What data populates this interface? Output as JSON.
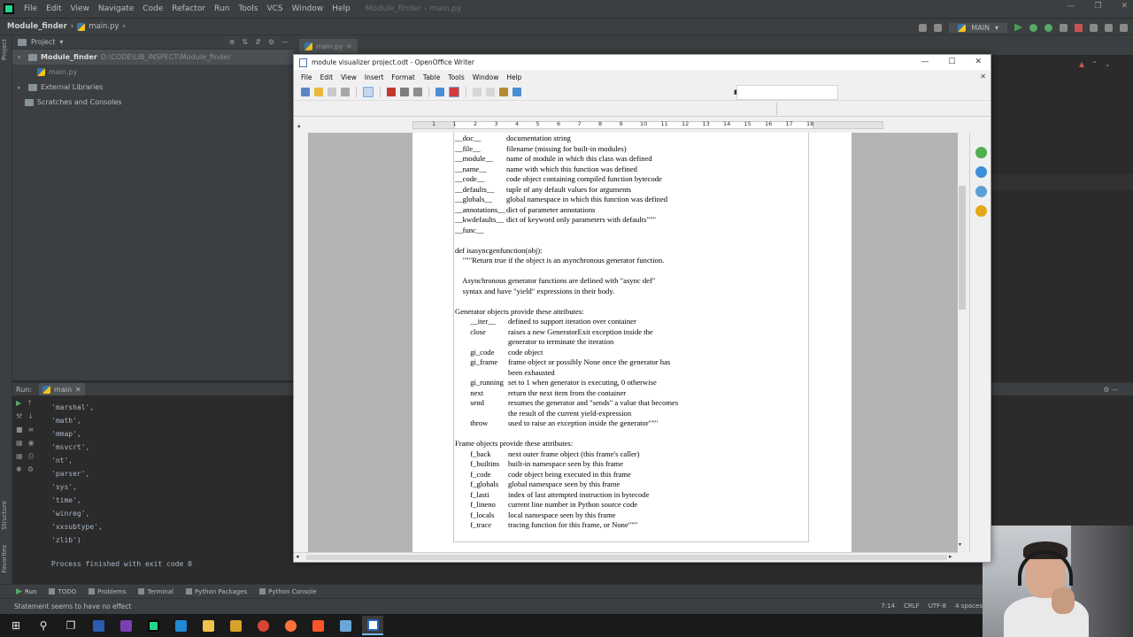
{
  "ide": {
    "menu": [
      "File",
      "Edit",
      "View",
      "Navigate",
      "Code",
      "Refactor",
      "Run",
      "Tools",
      "VCS",
      "Window",
      "Help"
    ],
    "window_title": "Module_finder - main.py",
    "breadcrumb": {
      "project": "Module_finder",
      "file": "main.py"
    },
    "run_config": "MAIN",
    "project_panel": {
      "title": "Project",
      "tree": {
        "root": "Module_finder",
        "root_path": "D:\\CODE\\LIB_INSPECT\\Module_finder",
        "file": "main.py",
        "external": "External Libraries",
        "scratches": "Scratches and Consoles"
      }
    },
    "editor_tab": "main.py",
    "run_panel": {
      "label": "Run:",
      "tab": "main",
      "output": [
        "'marshal',",
        "'math',",
        "'mmap',",
        "'msvcrt',",
        "'nt',",
        "'parser',",
        "'sys',",
        "'time',",
        "'winreg',",
        "'xxsubtype',",
        "'zlib')"
      ],
      "process": "Process finished with exit code 0"
    },
    "bottom_tabs": {
      "run": "Run",
      "todo": "TODO",
      "problems": "Problems",
      "terminal": "Terminal",
      "packages": "Python Packages",
      "console": "Python Console"
    },
    "status": {
      "message": "Statement seems to have no effect",
      "position": "7:14",
      "line_sep": "CRLF",
      "encoding": "UTF-8",
      "indent": "4 spaces"
    },
    "left_strip": {
      "project": "Project",
      "structure": "Structure",
      "favorites": "Favorites"
    }
  },
  "writer": {
    "title": "module visualizer project.odt - OpenOffice Writer",
    "menu": [
      "File",
      "Edit",
      "View",
      "Insert",
      "Format",
      "Table",
      "Tools",
      "Window",
      "Help"
    ],
    "ruler_numbers": [
      "1",
      "1",
      "2",
      "3",
      "4",
      "5",
      "6",
      "7",
      "8",
      "9",
      "10",
      "11",
      "12",
      "13",
      "14",
      "15",
      "16",
      "17",
      "18"
    ],
    "lines": [
      {
        "a": "__doc__",
        "b": "documentation string"
      },
      {
        "a": "__file__",
        "b": "filename (missing for built-in modules)"
      },
      {
        "a": "__module__",
        "b": "name of module in which this class was defined"
      },
      {
        "a": "__name__",
        "b": "name with which this function was defined"
      },
      {
        "a": "__code__",
        "b": "code object containing compiled function bytecode"
      },
      {
        "a": "__defaults__",
        "b": "tuple of any default values for arguments"
      },
      {
        "a": "__globals__",
        "b": "global namespace in which this function was defined"
      },
      {
        "a": "__annotations__",
        "b": "dict of parameter annotations"
      },
      {
        "a": "__kwdefaults__",
        "b": "dict of keyword only parameters with defaults\"\"\""
      },
      {
        "a": "__func__",
        "b": ""
      },
      {
        "a": "",
        "b": ""
      },
      {
        "a": "def isasyncgenfunction(obj):",
        "b": ""
      },
      {
        "a": "    \"\"\"Return true if the object is an asynchronous generator function.",
        "b": ""
      },
      {
        "a": "",
        "b": ""
      },
      {
        "a": "    Asynchronous generator functions are defined with \"async def\"",
        "b": ""
      },
      {
        "a": "    syntax and have \"yield\" expressions in their body.",
        "b": ""
      },
      {
        "a": "",
        "b": ""
      },
      {
        "a": "Generator objects provide these attributes:",
        "b": ""
      },
      {
        "a": "        __iter__",
        "b": "defined to support iteration over container"
      },
      {
        "a": "        close",
        "b": "raises a new GeneratorExit exception inside the"
      },
      {
        "a": "",
        "b": "generator to terminate the iteration"
      },
      {
        "a": "        gi_code",
        "b": "code object"
      },
      {
        "a": "        gi_frame",
        "b": "frame object or possibly None once the generator has"
      },
      {
        "a": "",
        "b": "been exhausted"
      },
      {
        "a": "        gi_running",
        "b": "set to 1 when generator is executing, 0 otherwise"
      },
      {
        "a": "        next",
        "b": "return the next item from the container"
      },
      {
        "a": "        send",
        "b": "resumes the generator and \"sends\" a value that becomes"
      },
      {
        "a": "",
        "b": "the result of the current yield-expression"
      },
      {
        "a": "        throw",
        "b": "used to raise an exception inside the generator\"\"\""
      },
      {
        "a": "",
        "b": ""
      },
      {
        "a": "Frame objects provide these attributes:",
        "b": ""
      },
      {
        "a": "        f_back",
        "b": "next outer frame object (this frame's caller)"
      },
      {
        "a": "        f_builtins",
        "b": "built-in namespace seen by this frame"
      },
      {
        "a": "        f_code",
        "b": "code object being executed in this frame"
      },
      {
        "a": "        f_globals",
        "b": "global namespace seen by this frame"
      },
      {
        "a": "        f_lasti",
        "b": "index of last attempted instruction in bytecode"
      },
      {
        "a": "        f_lineno",
        "b": "current line number in Python source code"
      },
      {
        "a": "        f_locals",
        "b": "local namespace seen by this frame"
      },
      {
        "a": "        f_trace",
        "b": "tracing function for this frame, or None\"\"\""
      }
    ]
  }
}
